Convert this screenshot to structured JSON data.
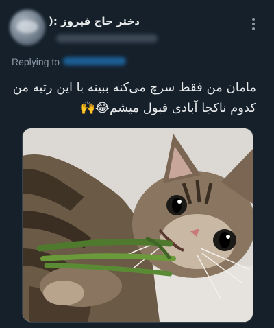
{
  "tweet": {
    "display_name": "دختر حاج فیروز :(",
    "replying_label": "Replying to",
    "text_line_1": "مامان من فقط سرچ می‌کنه ببینه با این رتبه من",
    "text_line_2": "کدوم ناکجا آبادی قبول میشم😂🙌",
    "media_description_icon": "cat-photo"
  },
  "colors": {
    "background": "#15202b",
    "primary_text": "#e7e9ea",
    "secondary_text": "#8b98a5",
    "link": "#1d9bf0"
  }
}
